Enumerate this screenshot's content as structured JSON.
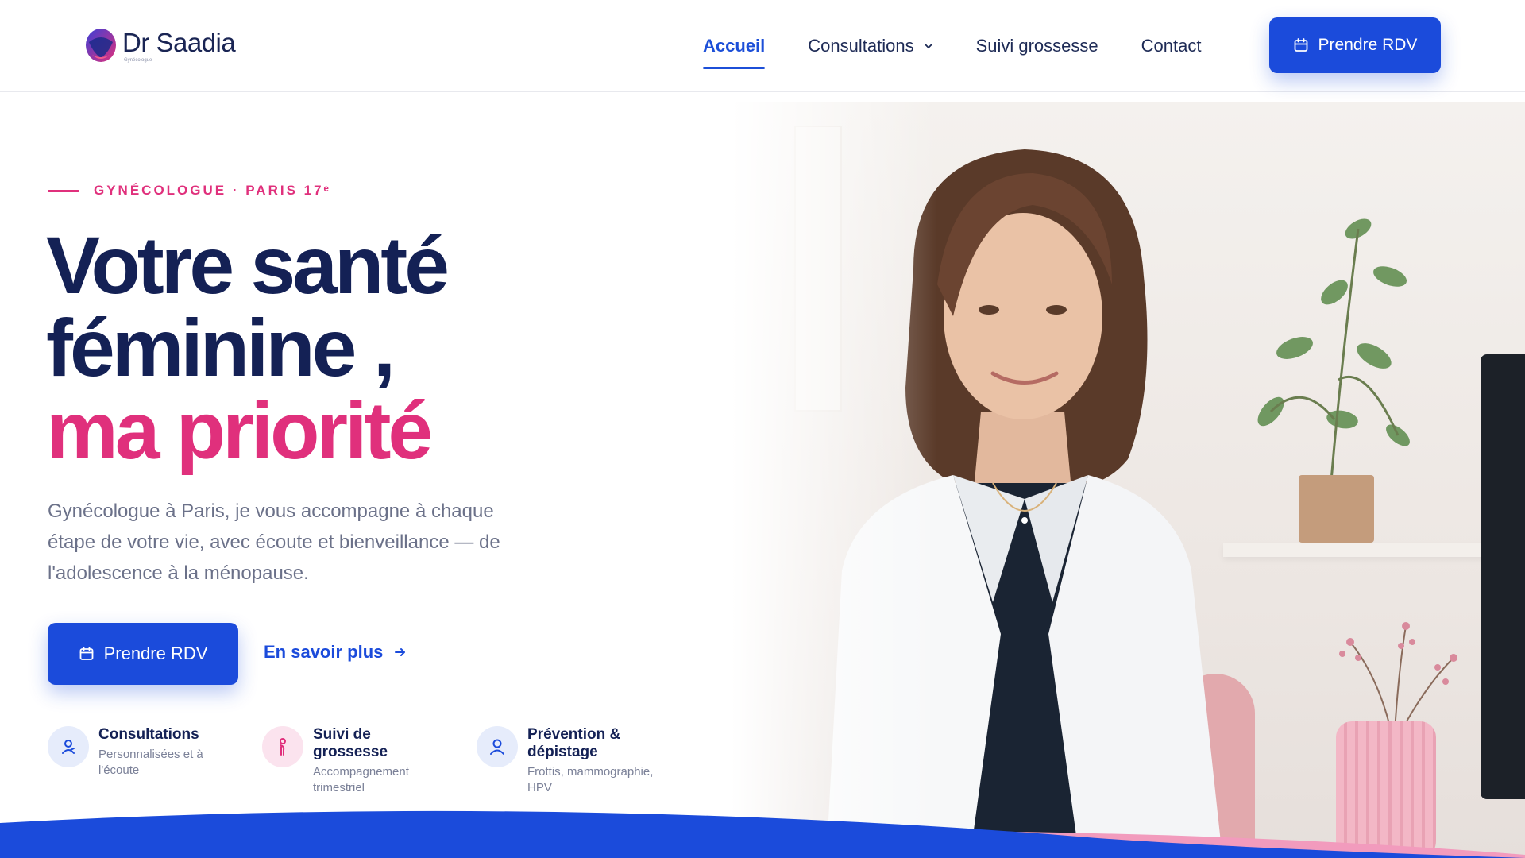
{
  "colors": {
    "primary": "#1b4bdb",
    "accent_pink": "#e0307c",
    "navy": "#142155",
    "muted": "#6b7189"
  },
  "brand": {
    "name": "Dr Saadia",
    "subtitle": "Gynécologue"
  },
  "nav": {
    "items": [
      {
        "label": "Accueil",
        "active": true
      },
      {
        "label": "Consultations",
        "has_dropdown": true
      },
      {
        "label": "Suivi grossesse"
      },
      {
        "label": "Contact"
      }
    ],
    "cta_label": "Prendre RDV"
  },
  "hero": {
    "eyebrow": "GYNÉCOLOGUE · PARIS 17ᵉ",
    "title_line1": "Votre santé",
    "title_line2": "féminine ,",
    "title_line3": "ma priorité",
    "lead": "Gynécologue à Paris, je vous accompagne à chaque étape de votre vie, avec écoute et bienveillance — de l'adolescence à la ménopause.",
    "cta_label": "Prendre RDV",
    "link_label": "En savoir plus"
  },
  "features": [
    {
      "title": "Consultations",
      "subtitle": "Personnalisées et à l'écoute",
      "icon": "user-icon"
    },
    {
      "title": "Suivi de grossesse",
      "subtitle": "Accompagnement trimestriel",
      "icon": "pregnancy-icon"
    },
    {
      "title": "Prévention & dépistage",
      "subtitle": "Frottis, mammographie, HPV",
      "icon": "profile-icon"
    }
  ]
}
